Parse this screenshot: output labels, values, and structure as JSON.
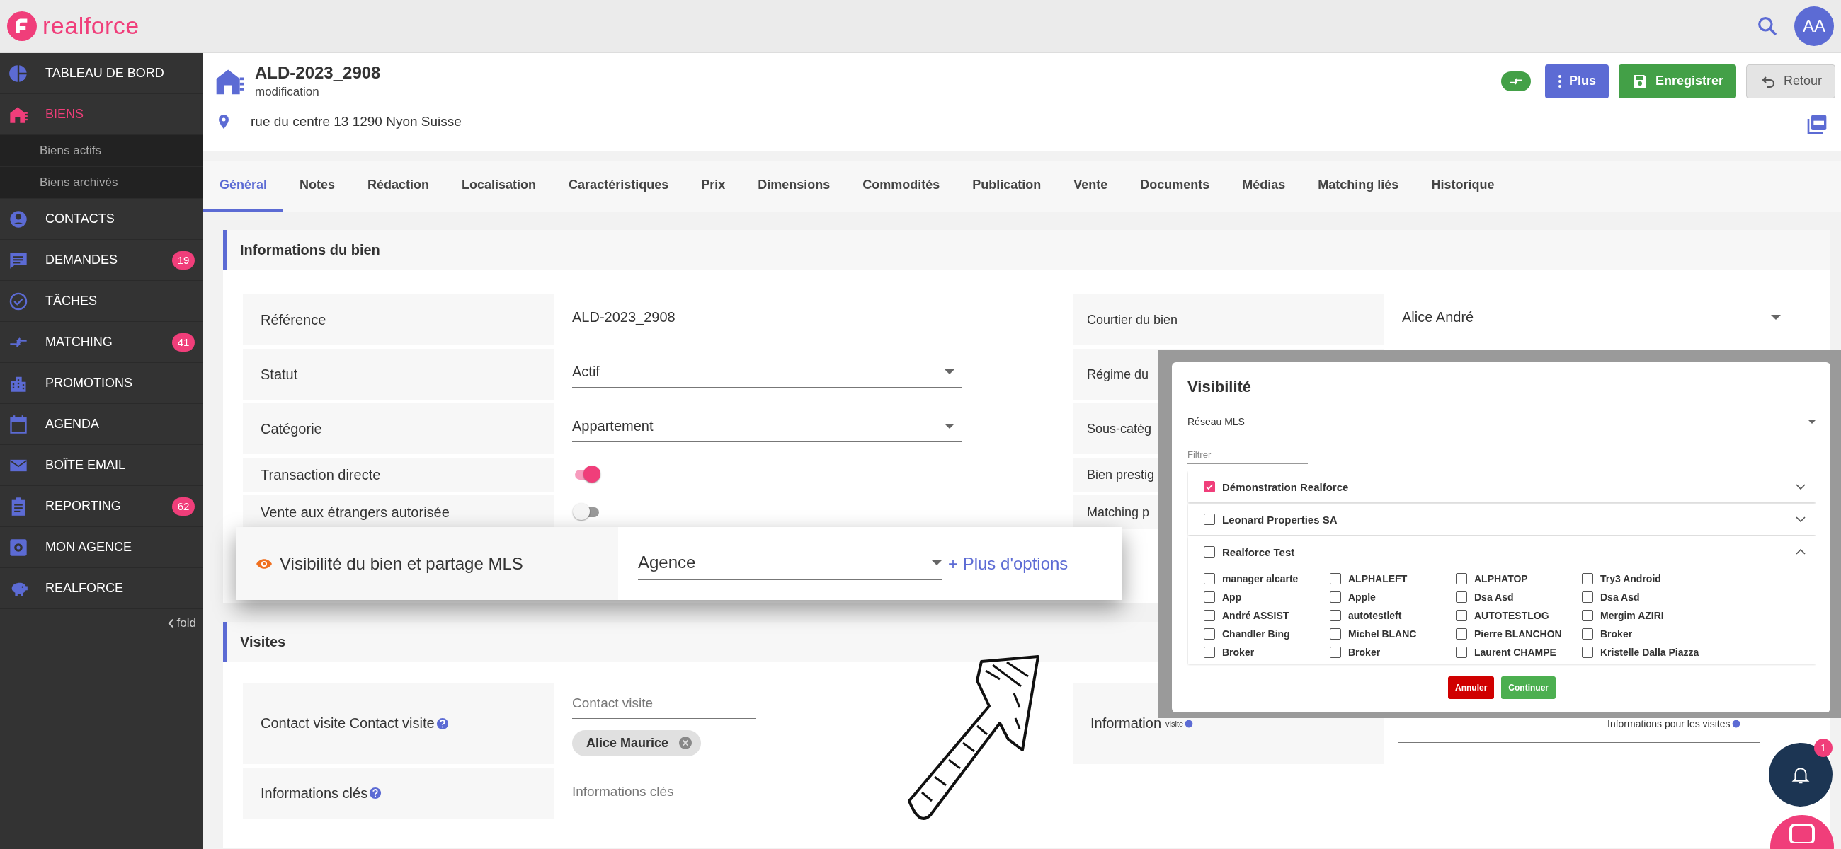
{
  "app": {
    "logo_text": "realforce",
    "avatar": "AA"
  },
  "sidebar": {
    "items": [
      {
        "label": "TABLEAU DE BORD",
        "selected": false
      },
      {
        "label": "BIENS",
        "selected": true,
        "children": [
          {
            "label": "Biens actifs",
            "selected": false
          },
          {
            "label": "Biens archivés",
            "selected": false
          }
        ]
      },
      {
        "label": "CONTACTS",
        "selected": false
      },
      {
        "label": "DEMANDES",
        "selected": false,
        "badge": "19"
      },
      {
        "label": "TÂCHES",
        "selected": false
      },
      {
        "label": "MATCHING",
        "selected": false,
        "badge": "41"
      },
      {
        "label": "PROMOTIONS",
        "selected": false
      },
      {
        "label": "AGENDA",
        "selected": false
      },
      {
        "label": "BOÎTE EMAIL",
        "selected": false
      },
      {
        "label": "REPORTING",
        "selected": false,
        "badge": "62"
      },
      {
        "label": "MON AGENCE",
        "selected": false
      },
      {
        "label": "REALFORCE",
        "selected": false
      }
    ],
    "fold": "fold"
  },
  "property": {
    "title": "ALD-2023_2908",
    "subtitle": "modification",
    "address": "rue du centre 13 1290 Nyon Suisse"
  },
  "actions": [
    {
      "label": "Plus",
      "kind": "menu"
    },
    {
      "label": "Enregistrer",
      "kind": "save"
    },
    {
      "label": "Retour",
      "kind": "back"
    }
  ],
  "tabs": [
    {
      "label": "Général",
      "selected": true
    },
    {
      "label": "Notes",
      "selected": false
    },
    {
      "label": "Rédaction",
      "selected": false
    },
    {
      "label": "Localisation",
      "selected": false
    },
    {
      "label": "Caractéristiques",
      "selected": false
    },
    {
      "label": "Prix",
      "selected": false
    },
    {
      "label": "Dimensions",
      "selected": false
    },
    {
      "label": "Commodités",
      "selected": false
    },
    {
      "label": "Publication",
      "selected": false
    },
    {
      "label": "Vente",
      "selected": false
    },
    {
      "label": "Documents",
      "selected": false
    },
    {
      "label": "Médias",
      "selected": false
    },
    {
      "label": "Matching liés",
      "selected": false
    },
    {
      "label": "Historique",
      "selected": false
    }
  ],
  "info_section": {
    "title": "Informations du bien",
    "left_rows": [
      {
        "label": "Référence",
        "kind": "text",
        "value": "ALD-2023_2908"
      },
      {
        "label": "Statut",
        "kind": "select",
        "value": "Actif"
      },
      {
        "label": "Catégorie",
        "kind": "select",
        "value": "Appartement"
      },
      {
        "label": "Transaction directe",
        "kind": "toggle",
        "on": true
      },
      {
        "label": "Vente aux étrangers autorisée",
        "kind": "toggle",
        "on": false
      }
    ],
    "right_rows": [
      {
        "label": "Courtier du bien",
        "kind": "select",
        "value": "Alice André"
      },
      {
        "label": "Régime du",
        "kind": "covered"
      },
      {
        "label": "Sous-catég",
        "kind": "covered"
      },
      {
        "label": "Bien prestig",
        "kind": "covered"
      },
      {
        "label": "Matching p",
        "kind": "covered"
      }
    ]
  },
  "visibility_callout": {
    "label": "Visibilité du bien et partage MLS",
    "value": "Agence",
    "link": "+ Plus d'options"
  },
  "visits_section": {
    "title": "Visites",
    "contact": {
      "label": "Contact visite Contact visite",
      "placeholder": "Contact visite",
      "chips": [
        "Alice Maurice"
      ]
    },
    "key_info": {
      "label": "Informations clés",
      "placeholder": "Informations clés"
    },
    "right_label": "Information",
    "right_note": "visite",
    "info_label": "Informations pour les visites"
  },
  "visibility_dialog": {
    "title": "Visibilité",
    "network": "Réseau MLS",
    "filter_placeholder": "Filtrer",
    "groups": [
      {
        "name": "Démonstration Realforce",
        "checked": true,
        "expanded": false
      },
      {
        "name": "Leonard Properties SA",
        "checked": false,
        "expanded": false
      },
      {
        "name": "Realforce Test",
        "checked": false,
        "expanded": true,
        "members": [
          {
            "name": "manager alcarte",
            "checked": false
          },
          {
            "name": "ALPHALEFT",
            "checked": false
          },
          {
            "name": "ALPHATOP",
            "checked": false
          },
          {
            "name": "Try3 Android",
            "checked": false
          },
          {
            "name": "App",
            "checked": false
          },
          {
            "name": "Apple",
            "checked": false
          },
          {
            "name": "Dsa Asd",
            "checked": false
          },
          {
            "name": "Dsa Asd",
            "checked": false
          },
          {
            "name": "André ASSIST",
            "checked": false
          },
          {
            "name": "autotestleft",
            "checked": false
          },
          {
            "name": "AUTOTESTLOG",
            "checked": false
          },
          {
            "name": "Mergim AZIRI",
            "checked": false
          },
          {
            "name": "Chandler Bing",
            "checked": false
          },
          {
            "name": "Michel BLANC",
            "checked": false
          },
          {
            "name": "Pierre BLANCHON",
            "checked": false
          },
          {
            "name": "Broker",
            "checked": false
          },
          {
            "name": "Broker",
            "checked": false
          },
          {
            "name": "Broker",
            "checked": false
          },
          {
            "name": "Laurent CHAMPE",
            "checked": false
          },
          {
            "name": "Kristelle Dalla Piazza",
            "checked": false
          }
        ]
      }
    ],
    "buttons": [
      {
        "label": "Annuler",
        "kind": "cancel"
      },
      {
        "label": "Continuer",
        "kind": "confirm"
      }
    ]
  },
  "notifications": {
    "count": "1"
  }
}
